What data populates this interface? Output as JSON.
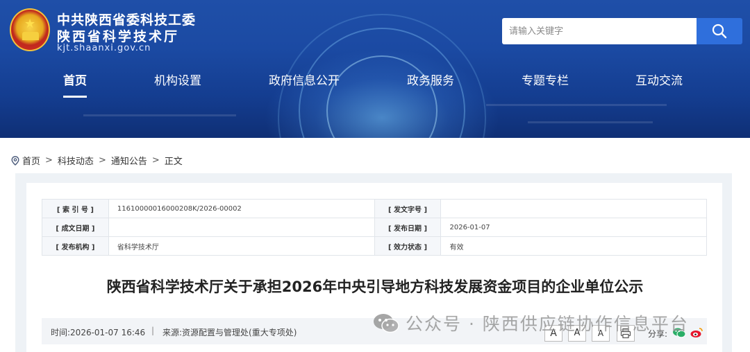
{
  "header": {
    "org_line1": "中共陕西省委科技工委",
    "org_line2": "陕西省科学技术厅",
    "domain": "kjt.shaanxi.gov.cn",
    "search_placeholder": "请输入关键字",
    "search_icon": "search-icon"
  },
  "nav": {
    "items": [
      {
        "label": "首页",
        "active": true
      },
      {
        "label": "机构设置"
      },
      {
        "label": "政府信息公开"
      },
      {
        "label": "政务服务"
      },
      {
        "label": "专题专栏"
      },
      {
        "label": "互动交流"
      }
    ]
  },
  "breadcrumb": {
    "icon": "location-pin-icon",
    "items": [
      "首页",
      "科技动态",
      "通知公告",
      "正文"
    ],
    "separator": ">"
  },
  "meta": {
    "index_label": "[ 索 引 号 ]",
    "index_value": "11610000016000208K/2026-00002",
    "docno_label": "[ 发文字号 ]",
    "docno_value": "",
    "date_made_label": "[ 成文日期 ]",
    "date_made_value": "",
    "pub_date_label": "[ 发布日期 ]",
    "pub_date_value": "2026-01-07",
    "issuer_label": "[ 发布机构 ]",
    "issuer_value": "省科学技术厅",
    "status_label": "[ 效力状态 ]",
    "status_value": "有效"
  },
  "article": {
    "title": "陕西省科学技术厅关于承担2026年中央引导地方科技发展资金项目的企业单位公示",
    "time_text": "时间:2026-01-07 16:46",
    "divider": "|",
    "source_text": "来源:资源配置与管理处(重大专项处)"
  },
  "tools": {
    "font_large": "A",
    "font_medium": "A",
    "font_small": "A",
    "print_icon": "print-icon",
    "share_label": "分享:",
    "wechat_icon": "wechat-icon",
    "weibo_icon": "weibo-icon"
  },
  "watermark": {
    "text": "公众号 · 陕西供应链协作信息平台",
    "icon": "wechat-logo-icon"
  },
  "colors": {
    "banner": "#1b4aa3",
    "search_button": "#2f6fdc",
    "status_valid": "#2e8b2e"
  }
}
